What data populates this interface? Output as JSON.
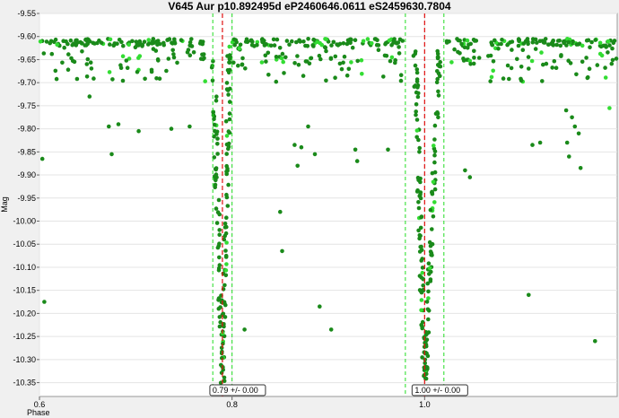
{
  "chart_data": {
    "type": "scatter",
    "title": "V645 Aur p10.892495d eP2460646.0611 eS2459630.7804",
    "xlabel": "Phase",
    "ylabel": "Mag",
    "xlim": [
      0.6,
      1.2
    ],
    "ylim": [
      -10.38,
      -9.55
    ],
    "x_ticks": [
      "0.6",
      "0.8",
      "1.0"
    ],
    "x_tick_values": [
      0.6,
      0.8,
      1.0
    ],
    "y_ticks": [
      "-9.55",
      "-9.60",
      "-9.65",
      "-9.70",
      "-9.75",
      "-9.80",
      "-9.85",
      "-9.90",
      "-9.95",
      "-10.00",
      "-10.05",
      "-10.10",
      "-10.15",
      "-10.20",
      "-10.25",
      "-10.30",
      "-10.35"
    ],
    "y_tick_values": [
      -9.55,
      -9.6,
      -9.65,
      -9.7,
      -9.75,
      -9.8,
      -9.85,
      -9.9,
      -9.95,
      -10.0,
      -10.05,
      -10.1,
      -10.15,
      -10.2,
      -10.25,
      -10.3,
      -10.35
    ],
    "grid": true,
    "minima": [
      {
        "phase": 0.79,
        "lower": 0.78,
        "upper": 0.8,
        "label": "0.79 +/- 0.00"
      },
      {
        "phase": 1.0,
        "lower": 0.98,
        "upper": 1.02,
        "label": "1.00 +/- 0.00"
      }
    ],
    "colors": {
      "point": "#1a8a1a",
      "point_light": "#33dd33",
      "minimum_line": "#e01010",
      "bound_line": "#22dd22",
      "grid": "#e4e4e4"
    },
    "scattered_points": [
      [
        0.603,
        -9.865
      ],
      [
        0.605,
        -10.175
      ],
      [
        0.652,
        -9.73
      ],
      [
        0.672,
        -9.795
      ],
      [
        0.675,
        -9.855
      ],
      [
        0.682,
        -9.79
      ],
      [
        0.703,
        -9.805
      ],
      [
        0.737,
        -9.8
      ],
      [
        0.756,
        -9.795
      ],
      [
        0.813,
        -10.235
      ],
      [
        0.85,
        -9.98
      ],
      [
        0.852,
        -10.065
      ],
      [
        0.865,
        -9.835
      ],
      [
        0.868,
        -9.88
      ],
      [
        0.872,
        -9.84
      ],
      [
        0.879,
        -9.795
      ],
      [
        0.886,
        -9.855
      ],
      [
        0.891,
        -10.185
      ],
      [
        0.903,
        -10.235
      ],
      [
        0.928,
        -9.845
      ],
      [
        0.93,
        -9.87
      ],
      [
        0.962,
        -9.845
      ],
      [
        1.042,
        -9.89
      ],
      [
        1.047,
        -9.905
      ],
      [
        1.108,
        -10.16
      ],
      [
        1.112,
        -9.835
      ],
      [
        1.12,
        -9.83
      ],
      [
        1.147,
        -9.76
      ],
      [
        1.148,
        -9.83
      ],
      [
        1.15,
        -9.86
      ],
      [
        1.153,
        -9.775
      ],
      [
        1.156,
        -9.795
      ],
      [
        1.16,
        -9.81
      ],
      [
        1.162,
        -9.885
      ],
      [
        1.177,
        -10.26
      ],
      [
        1.192,
        -9.755
      ]
    ]
  }
}
